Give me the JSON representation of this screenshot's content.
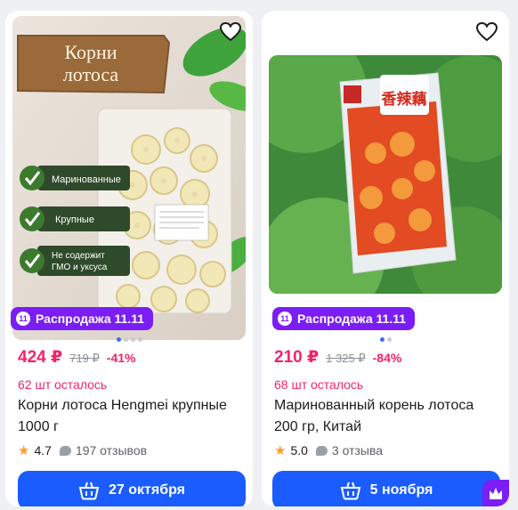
{
  "products": [
    {
      "image_text": {
        "title_line1": "Корни",
        "title_line2": "лотоса",
        "feature1": "Маринованные",
        "feature2": "Крупные",
        "feature3_line1": "Не содержит",
        "feature3_line2": "ГМО и уксуса"
      },
      "sale_badge": "Распродажа 11.11",
      "price": "424 ₽",
      "old_price": "719 ₽",
      "discount": "-41%",
      "stock": "62 шт осталось",
      "title_line1": "Корни лотоса Hengmei крупные",
      "title_line2": "1000 г",
      "rating": "4.7",
      "reviews": "197 отзывов",
      "delivery": "27 октября",
      "image_dots": 4,
      "active_dot": 0
    },
    {
      "image_text": {
        "pack_chars": "香辣藕"
      },
      "sale_badge": "Распродажа 11.11",
      "price": "210 ₽",
      "old_price": "1 325 ₽",
      "discount": "-84%",
      "stock": "68 шт осталось",
      "title_line1": "Маринованный корень лотоса",
      "title_line2": "200 гр, Китай",
      "rating": "5.0",
      "reviews": "3 отзыва",
      "delivery": "5 ноября",
      "image_dots": 2,
      "active_dot": 0
    }
  ],
  "colors": {
    "accent": "#1a5cff",
    "price": "#f5226b",
    "sale": "#7a1ef5",
    "star": "#ff9d2a"
  }
}
